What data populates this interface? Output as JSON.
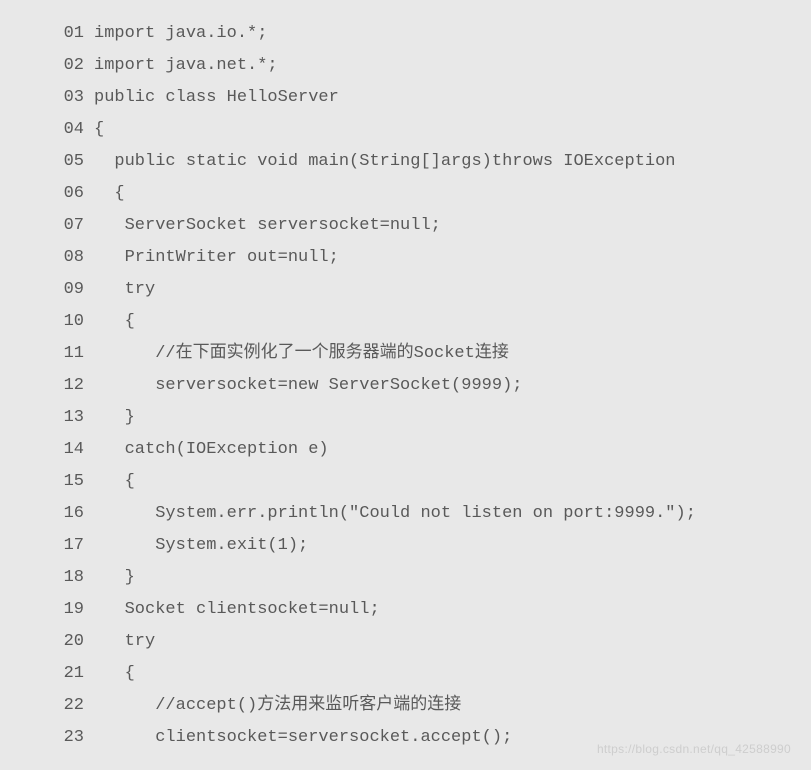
{
  "code": {
    "lines": [
      {
        "num": "01",
        "text": "import java.io.*;"
      },
      {
        "num": "02",
        "text": "import java.net.*;"
      },
      {
        "num": "03",
        "text": "public class HelloServer"
      },
      {
        "num": "04",
        "text": "{"
      },
      {
        "num": "05",
        "text": "  public static void main(String[]args)throws IOException"
      },
      {
        "num": "06",
        "text": "  {"
      },
      {
        "num": "07",
        "text": "   ServerSocket serversocket=null;"
      },
      {
        "num": "08",
        "text": "   PrintWriter out=null;"
      },
      {
        "num": "09",
        "text": "   try"
      },
      {
        "num": "10",
        "text": "   {"
      },
      {
        "num": "11",
        "text": "      //在下面实例化了一个服务器端的Socket连接"
      },
      {
        "num": "12",
        "text": "      serversocket=new ServerSocket(9999);"
      },
      {
        "num": "13",
        "text": "   }"
      },
      {
        "num": "14",
        "text": "   catch(IOException e)"
      },
      {
        "num": "15",
        "text": "   {"
      },
      {
        "num": "16",
        "text": "      System.err.println(\"Could not listen on port:9999.\");"
      },
      {
        "num": "17",
        "text": "      System.exit(1);"
      },
      {
        "num": "18",
        "text": "   }"
      },
      {
        "num": "19",
        "text": "   Socket clientsocket=null;"
      },
      {
        "num": "20",
        "text": "   try"
      },
      {
        "num": "21",
        "text": "   {"
      },
      {
        "num": "22",
        "text": "      //accept()方法用来监听客户端的连接"
      },
      {
        "num": "23",
        "text": "      clientsocket=serversocket.accept();"
      }
    ]
  },
  "watermark": "https://blog.csdn.net/qq_42588990"
}
